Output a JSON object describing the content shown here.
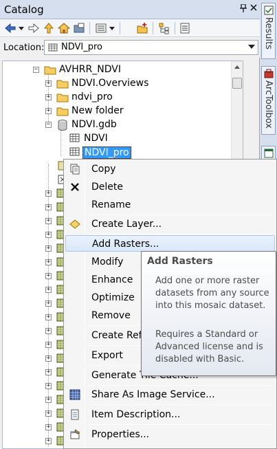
{
  "window": {
    "title": "Catalog",
    "pin_symbol": "❘",
    "close_symbol": "✕"
  },
  "location": {
    "label": "Location:",
    "value": "NDVI_pro"
  },
  "tree": {
    "root": "AVHRR_NDVI",
    "folders": [
      "NDVI.Overviews",
      "ndvi_pro",
      "New folder"
    ],
    "gdb": "NDVI.gdb",
    "gdb_items": [
      "NDVI",
      "NDVI_pro"
    ]
  },
  "side_tabs": [
    "Results",
    "ArcToolbox"
  ],
  "context_menu": {
    "items": [
      {
        "label": "Copy",
        "icon": "copy-icon"
      },
      {
        "label": "Delete",
        "icon": "delete-icon"
      },
      {
        "label": "Rename",
        "icon": ""
      },
      {
        "label": "Create Layer...",
        "icon": "create-layer-icon"
      },
      {
        "label": "Add Rasters...",
        "icon": ""
      },
      {
        "label": "Modify",
        "icon": ""
      },
      {
        "label": "Enhance",
        "icon": ""
      },
      {
        "label": "Optimize",
        "icon": ""
      },
      {
        "label": "Remove",
        "icon": ""
      },
      {
        "label": "Create Refe",
        "icon": ""
      },
      {
        "label": "Export",
        "icon": ""
      },
      {
        "label": "Generate Tile Cache...",
        "icon": ""
      },
      {
        "label": "Share As Image Service...",
        "icon": "image-service-icon"
      },
      {
        "label": "Item Description...",
        "icon": "item-description-icon"
      },
      {
        "label": "Properties...",
        "icon": "properties-icon"
      }
    ]
  },
  "tooltip": {
    "title": "Add Rasters",
    "text1": "Add one or more raster datasets from any source into this mosaic dataset.",
    "text2": "Requires a Standard or Advanced license and is disabled with Basic."
  },
  "colors": {
    "selection": "#3399ff",
    "titlebar": "#d6dfee",
    "menu_hover": "#d9e8fb"
  }
}
